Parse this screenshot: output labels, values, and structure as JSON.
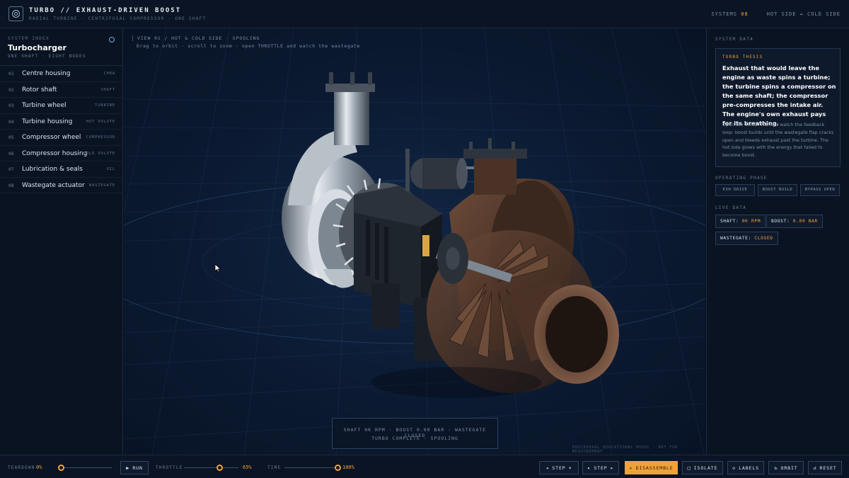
{
  "app": {
    "title": "TURBO // EXHAUST-DRIVEN BOOST",
    "subtitle": "RADIAL TURBINE · CENTRIFUGAL COMPRESSOR · ONE SHAFT",
    "systems_label": "SYSTEMS",
    "systems_count": "08",
    "side_label": "HOT SIDE ↔ COLD SIDE"
  },
  "sidebar": {
    "index_label": "SYSTEM INDEX",
    "system_name": "Turbocharger",
    "system_sub": "ONE SHAFT · EIGHT NODES",
    "items": [
      {
        "num": "01",
        "name": "Centre housing",
        "tag": "CHRA"
      },
      {
        "num": "02",
        "name": "Rotor shaft",
        "tag": "SHAFT"
      },
      {
        "num": "03",
        "name": "Turbine wheel",
        "tag": "TURBINE"
      },
      {
        "num": "04",
        "name": "Turbine housing",
        "tag": "HOT VOLUTE"
      },
      {
        "num": "05",
        "name": "Compressor wheel",
        "tag": "COMPRESSOR"
      },
      {
        "num": "06",
        "name": "Compressor housing",
        "tag": "COLD VOLUTE"
      },
      {
        "num": "07",
        "name": "Lubrication & seals",
        "tag": "OIL"
      },
      {
        "num": "08",
        "name": "Wastegate actuator",
        "tag": "WASTEGATE"
      }
    ]
  },
  "viewport": {
    "view_label": "VIEW 01 / HOT & COLD SIDE · SPOOLING",
    "hint": "Drag to orbit · scroll to zoom · open THROTTLE and watch the wastegate",
    "status_line1": "SHAFT 0K RPM · BOOST 0.00 BAR · WASTEGATE CLOSED",
    "status_line2": "TURBO COMPLETE · SPOOLING",
    "disclaimer": "PROCEDURAL EDUCATIONAL MODEL · NOT FOR MEASUREMENT"
  },
  "panel": {
    "label": "SYSTEM DATA",
    "thesis_label": "TURBO THESIS",
    "thesis_bold": "Exhaust that would leave the engine as waste spins a turbine; the turbine spins a compressor on the same shaft; the compressor pre-compresses the intake air. The engine's own exhaust pays for its breathing.",
    "thesis_body": "Open the THROTTLE and watch the feedback loop: boost builds until the wastegate flap cracks open and bleeds exhaust past the turbine. The hot side glows with the energy that failed to become boost.",
    "phase_label": "OPERATING PHASE",
    "phases": [
      "EXH DRIVE",
      "BOOST BUILD",
      "BYPASS OPEN"
    ],
    "live_label": "LIVE DATA",
    "shaft_label": "SHAFT:",
    "shaft_value": "0K RPM",
    "boost_label": "BOOST:",
    "boost_value": "0.00 BAR",
    "wastegate_label": "WASTEGATE:",
    "wastegate_value": "CLOSED"
  },
  "controls": {
    "teardown_label": "TEARDOWN",
    "teardown_value": "0%",
    "teardown_level": 0,
    "run_label": "RUN",
    "throttle_label": "THROTTLE",
    "throttle_value": "65%",
    "throttle_level": 0.65,
    "time_label": "TIME",
    "time_value": "100%",
    "time_level": 1.0,
    "step_back_label": "STEP",
    "step_fwd_label": "STEP",
    "disassemble_label": "DISASSEMBLE",
    "isolate_label": "ISOLATE",
    "labels_label": "LABELS",
    "orbit_label": "ORBIT",
    "reset_label": "RESET"
  },
  "colors": {
    "accent": "#f2a33a",
    "background": "#0a1220",
    "panel": "#0e192b"
  }
}
